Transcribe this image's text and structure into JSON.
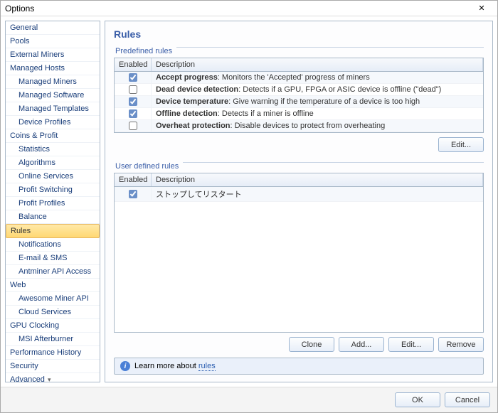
{
  "window": {
    "title": "Options",
    "close": "✕"
  },
  "sidebar": {
    "items": [
      {
        "label": "General",
        "type": "top"
      },
      {
        "label": "Pools",
        "type": "top"
      },
      {
        "label": "External Miners",
        "type": "top"
      },
      {
        "label": "Managed Hosts",
        "type": "top"
      },
      {
        "label": "Managed Miners",
        "type": "child"
      },
      {
        "label": "Managed Software",
        "type": "child"
      },
      {
        "label": "Managed Templates",
        "type": "child"
      },
      {
        "label": "Device Profiles",
        "type": "child"
      },
      {
        "label": "Coins & Profit",
        "type": "top"
      },
      {
        "label": "Statistics",
        "type": "child"
      },
      {
        "label": "Algorithms",
        "type": "child"
      },
      {
        "label": "Online Services",
        "type": "child"
      },
      {
        "label": "Profit Switching",
        "type": "child"
      },
      {
        "label": "Profit Profiles",
        "type": "child"
      },
      {
        "label": "Balance",
        "type": "child"
      },
      {
        "label": "Rules",
        "type": "top",
        "selected": true
      },
      {
        "label": "Notifications",
        "type": "child"
      },
      {
        "label": "E-mail & SMS",
        "type": "child"
      },
      {
        "label": "Antminer API Access",
        "type": "child"
      },
      {
        "label": "Web",
        "type": "top"
      },
      {
        "label": "Awesome Miner API",
        "type": "child"
      },
      {
        "label": "Cloud Services",
        "type": "child"
      },
      {
        "label": "GPU Clocking",
        "type": "top"
      },
      {
        "label": "MSI Afterburner",
        "type": "child"
      },
      {
        "label": "Performance History",
        "type": "top"
      },
      {
        "label": "Security",
        "type": "top"
      },
      {
        "label": "Advanced",
        "type": "top",
        "chev": true
      }
    ]
  },
  "main": {
    "title": "Rules",
    "predefined": {
      "label": "Predefined rules",
      "headers": {
        "enabled": "Enabled",
        "desc": "Description"
      },
      "rows": [
        {
          "enabled": true,
          "name": "Accept progress",
          "desc": "Monitors the 'Accepted' progress of miners"
        },
        {
          "enabled": false,
          "name": "Dead device detection",
          "desc": "Detects if a GPU, FPGA or ASIC device is offline (\"dead\")"
        },
        {
          "enabled": true,
          "name": "Device temperature",
          "desc": "Give warning if the temperature of a device is too high"
        },
        {
          "enabled": true,
          "name": "Offline detection",
          "desc": "Detects if a miner is offline"
        },
        {
          "enabled": false,
          "name": "Overheat protection",
          "desc": "Disable devices to protect from overheating"
        }
      ],
      "edit": "Edit..."
    },
    "user": {
      "label": "User defined rules",
      "headers": {
        "enabled": "Enabled",
        "desc": "Description"
      },
      "rows": [
        {
          "enabled": true,
          "desc": "ストップしてリスタート"
        }
      ],
      "buttons": {
        "clone": "Clone",
        "add": "Add...",
        "edit": "Edit...",
        "remove": "Remove"
      }
    },
    "info": {
      "text": "Learn more about ",
      "link": "rules"
    }
  },
  "footer": {
    "ok": "OK",
    "cancel": "Cancel"
  }
}
